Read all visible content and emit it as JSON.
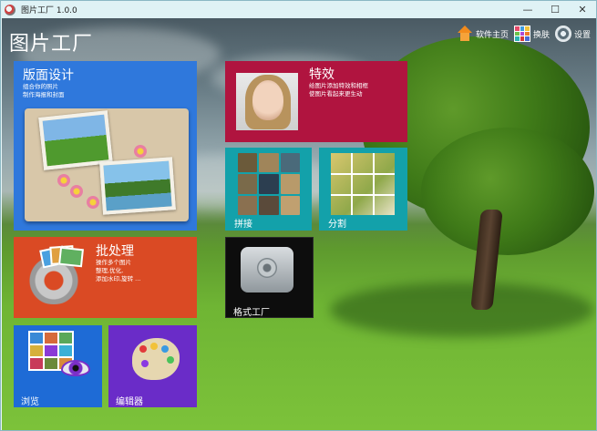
{
  "window": {
    "title": "图片工厂 1.0.0",
    "controls": {
      "minimize": "—",
      "maximize": "☐",
      "close": "✕"
    }
  },
  "app_title": "图片工厂",
  "topnav": {
    "home": "软件主页",
    "skin": "换肤",
    "settings": "设置"
  },
  "tiles": {
    "layout": {
      "title": "版面设计",
      "desc": "组合你的照片\n制作海报和封面"
    },
    "effects": {
      "title": "特效",
      "desc": "给图片添加特效和相框\n使图片看起来更生动"
    },
    "stitch": {
      "label": "拼接"
    },
    "split": {
      "label": "分割"
    },
    "batch": {
      "title": "批处理",
      "desc": "操作多个图片\n整理,优化,\n添加水印,旋转 ..."
    },
    "format": {
      "label": "格式工厂"
    },
    "browse": {
      "label": "浏览"
    },
    "editor": {
      "label": "编辑器"
    }
  },
  "colors": {
    "layout": "#2f78dc",
    "effects": "#b0143f",
    "stitch": "#13a1aa",
    "split": "#13a1aa",
    "batch": "#da4a24",
    "format": "#0d0d0d",
    "browse": "#1e6bd6",
    "editor": "#6a2cc8"
  },
  "icons": {
    "home": "house-icon",
    "skin": "palette-grid-icon",
    "settings": "gear-icon"
  }
}
